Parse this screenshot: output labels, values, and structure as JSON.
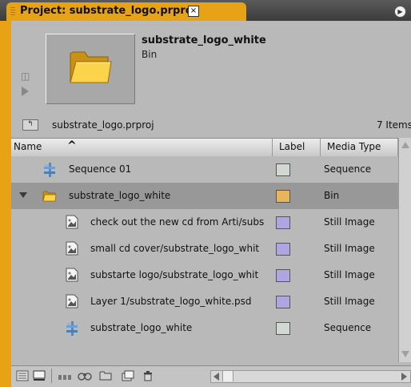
{
  "tab": {
    "title": "Project: substrate_logo.prproj",
    "close_glyph": "×"
  },
  "preview": {
    "name": "substrate_logo_white",
    "type": "Bin"
  },
  "project": {
    "name": "substrate_logo.prproj",
    "count": "7 Items"
  },
  "columns": {
    "name": "Name",
    "label": "Label",
    "media_type": "Media Type"
  },
  "rows": [
    {
      "name": "Sequence 01",
      "media_type": "Sequence",
      "label_color": "#cfd9d2",
      "icon": "sequence-icon",
      "indent": 0,
      "selected": false
    },
    {
      "name": "substrate_logo_white",
      "media_type": "Bin",
      "label_color": "#e8b55c",
      "icon": "folder-icon",
      "indent": 0,
      "selected": true,
      "expanded": true
    },
    {
      "name": "check out the new cd from Arti/subs",
      "media_type": "Still Image",
      "label_color": "#ada6e2",
      "icon": "still-image-icon",
      "indent": 1,
      "selected": false
    },
    {
      "name": "small cd cover/substrate_logo_whit",
      "media_type": "Still Image",
      "label_color": "#ada6e2",
      "icon": "still-image-icon",
      "indent": 1,
      "selected": false
    },
    {
      "name": "substarte logo/substrate_logo_whit",
      "media_type": "Still Image",
      "label_color": "#ada6e2",
      "icon": "still-image-icon",
      "indent": 1,
      "selected": false
    },
    {
      "name": "Layer 1/substrate_logo_white.psd",
      "media_type": "Still Image",
      "label_color": "#ada6e2",
      "icon": "still-image-icon",
      "indent": 1,
      "selected": false
    },
    {
      "name": "substrate_logo_white",
      "media_type": "Sequence",
      "label_color": "#cfd9d2",
      "icon": "sequence-icon",
      "indent": 1,
      "selected": false
    }
  ],
  "colors": {
    "accent": "#e7a216",
    "panel": "#b9b9b9",
    "selection": "#989898"
  }
}
